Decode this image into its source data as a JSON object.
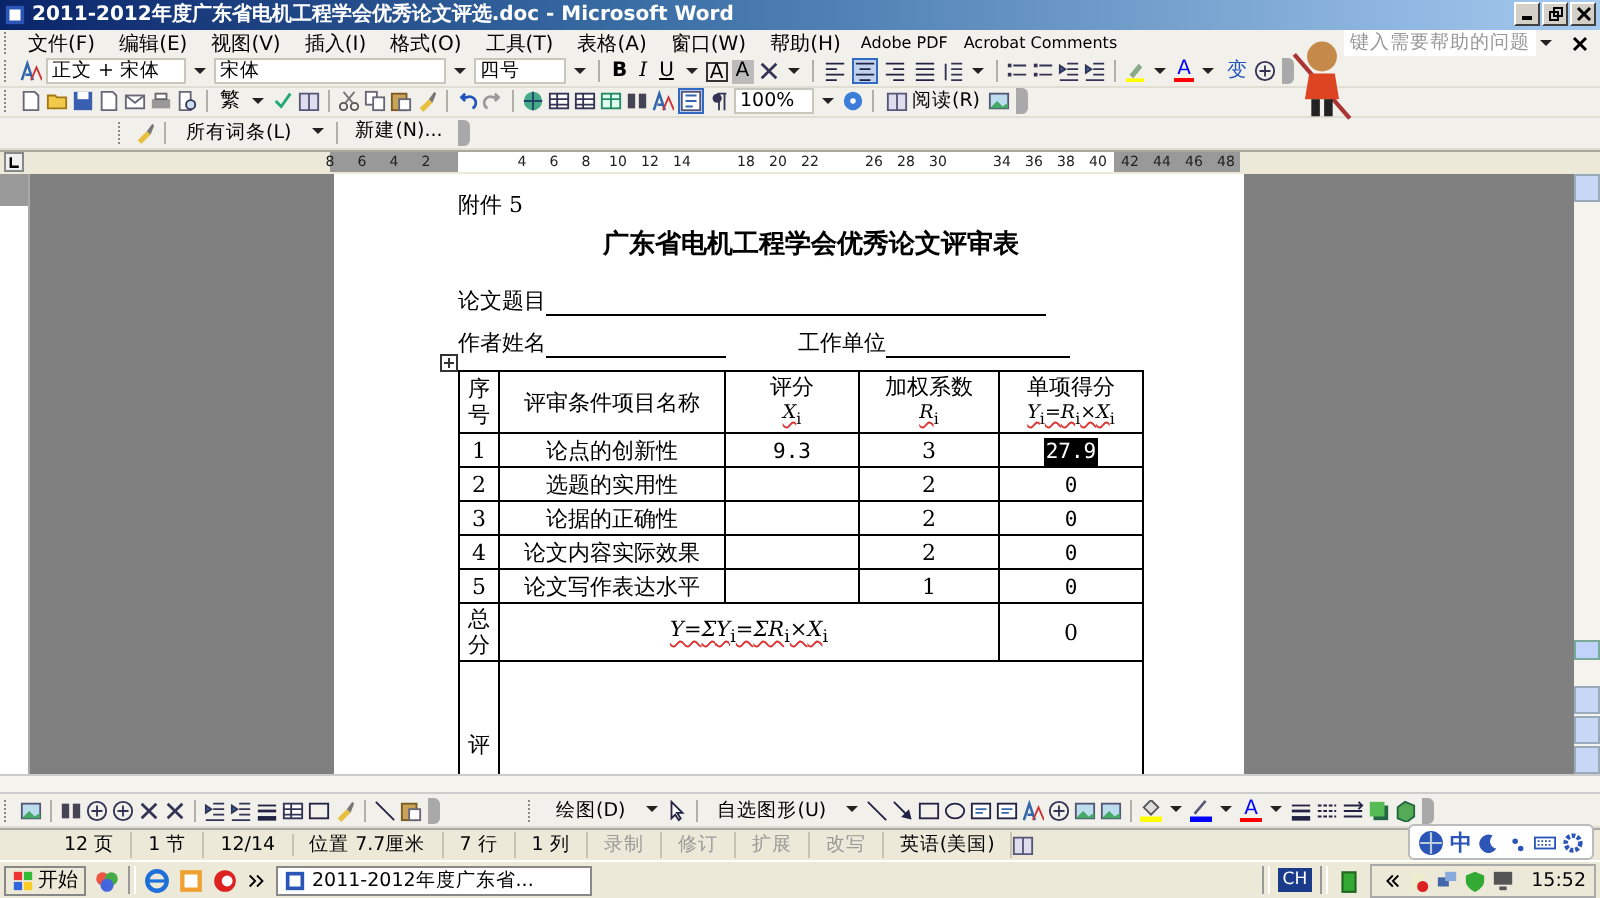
{
  "window": {
    "title": "2011-2012年度广东省电机工程学会优秀论文评选.doc - Microsoft Word"
  },
  "menu": [
    "文件(F)",
    "编辑(E)",
    "视图(V)",
    "插入(I)",
    "格式(O)",
    "工具(T)",
    "表格(A)",
    "窗口(W)",
    "帮助(H)",
    "Adobe PDF",
    "Acrobat Comments"
  ],
  "help_box": {
    "placeholder": "键入需要帮助的问题"
  },
  "formatting_toolbar": {
    "style": "正文 + 宋体",
    "font": "宋体",
    "size": "四号",
    "bold": "B",
    "italic": "I",
    "underline": "U",
    "char_border": "A",
    "char_shading": "A",
    "font_color": "A",
    "phonetic": "变",
    "alignments": [
      {
        "kind": "left",
        "selected": false
      },
      {
        "kind": "center",
        "selected": true
      },
      {
        "kind": "right",
        "selected": false
      },
      {
        "kind": "justify",
        "selected": false
      }
    ]
  },
  "standard_toolbar": {
    "convert": "繁",
    "zoom": "100%",
    "read": "阅读(R)",
    "document_map": {
      "selected": true
    }
  },
  "dictionary_toolbar": {
    "entries": "所有词条(L)",
    "new": "新建(N)..."
  },
  "ruler": {
    "left_numbers": [
      "8",
      "6",
      "4",
      "2"
    ],
    "right_numbers": [
      "4",
      "6",
      "8",
      "10",
      "12",
      "14",
      "18",
      "20",
      "22",
      "26",
      "28",
      "30",
      "34",
      "36",
      "38",
      "40",
      "42",
      "44",
      "46",
      "48"
    ]
  },
  "document": {
    "attachment": "附件 5",
    "title": "广东省电机工程学会优秀论文评审表",
    "topic_label": "论文题目",
    "author_label": "作者姓名",
    "unit_label": "工作单位",
    "table": {
      "header": [
        {
          "text": "序号"
        },
        {
          "text": "评审条件项目名称"
        },
        {
          "text": "评分",
          "formula": "*X*$_{i}$"
        },
        {
          "text": "加权系数",
          "formula": "*R*$_{i}$"
        },
        {
          "text": "单项得分",
          "formula": "*Y*$_{i}$=*R*$_{i}$×*X*$_{i}$"
        }
      ],
      "rows": [
        {
          "no": "1",
          "name": "论点的创新性",
          "score": "9.3",
          "weight": "3",
          "result": "27.9",
          "selected": true
        },
        {
          "no": "2",
          "name": "选题的实用性",
          "weight": "2",
          "result": "0",
          "selected": false
        },
        {
          "no": "3",
          "name": "论据的正确性",
          "weight": "2",
          "result": "0",
          "selected": false
        },
        {
          "no": "4",
          "name": "论文内容实际效果",
          "weight": "2",
          "result": "0",
          "selected": false
        },
        {
          "no": "5",
          "name": "论文写作表达水平",
          "weight": "1",
          "result": "0",
          "selected": false
        }
      ],
      "total": {
        "label": "总分",
        "formula": "*Y*=*ΣY*$_{i}$=*ΣR*$_{i}$×*X*$_{i}$",
        "value": "0"
      },
      "comment_label": "评"
    }
  },
  "drawing_toolbar": {
    "draw": "绘图(D)",
    "autoshapes": "自选图形(U)",
    "font_color": "A"
  },
  "status_bar": [
    {
      "text": "12 页",
      "disabled": false
    },
    {
      "text": "1 节",
      "disabled": false
    },
    {
      "text": "12/14",
      "disabled": false
    },
    {
      "text": "位置 7.7厘米",
      "disabled": false
    },
    {
      "text": "7 行",
      "disabled": false
    },
    {
      "text": "1 列",
      "disabled": false
    },
    {
      "text": "录制",
      "disabled": true
    },
    {
      "text": "修订",
      "disabled": true
    },
    {
      "text": "扩展",
      "disabled": true
    },
    {
      "text": "改写",
      "disabled": true
    },
    {
      "text": "英语(美国)",
      "disabled": false
    }
  ],
  "ime_bar": {
    "mode": "中"
  },
  "taskbar": {
    "start": "开始",
    "task": "2011-2012年度广东省...",
    "language": "CH",
    "clock": "15:52"
  }
}
